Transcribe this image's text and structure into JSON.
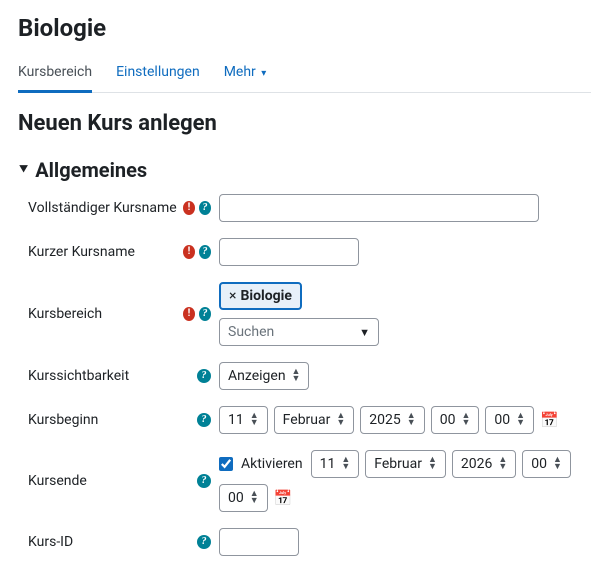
{
  "category_title": "Biologie",
  "tabs": {
    "kursbereich": "Kursbereich",
    "einstellungen": "Einstellungen",
    "mehr": "Mehr"
  },
  "page_title": "Neuen Kurs anlegen",
  "section": {
    "allgemeines": "Allgemeines"
  },
  "labels": {
    "fullname": "Vollständiger Kursname",
    "shortname": "Kurzer Kursname",
    "kursbereich": "Kursbereich",
    "visibility": "Kurssichtbarkeit",
    "startdate": "Kursbeginn",
    "enddate": "Kursende",
    "courseid": "Kurs-ID"
  },
  "values": {
    "fullname": "",
    "shortname": "",
    "kursbereich_chip": "Biologie",
    "kursbereich_search": "Suchen",
    "visibility": "Anzeigen",
    "courseid": ""
  },
  "start": {
    "day": "11",
    "month": "Februar",
    "year": "2025",
    "hour": "00",
    "minute": "00"
  },
  "end": {
    "enable_checked": true,
    "enable_label": "Aktivieren",
    "day": "11",
    "month": "Februar",
    "year": "2026",
    "hour": "00",
    "minute": "00"
  },
  "glyph": {
    "x": "×",
    "help": "?",
    "req": "!",
    "tri": "▼",
    "chev": "▾",
    "cal": "📅",
    "expand": "⯆"
  }
}
